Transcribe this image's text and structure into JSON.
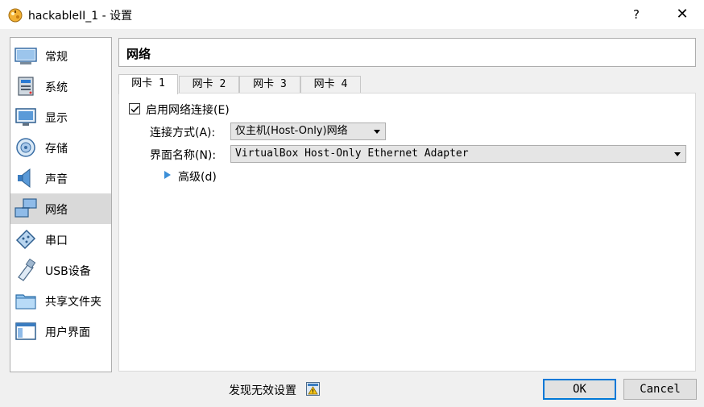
{
  "window": {
    "title": "hackableII_1 - 设置",
    "help_label": "?",
    "close_label": "✕"
  },
  "sidebar": {
    "items": [
      {
        "label": "常规",
        "icon": "general-icon"
      },
      {
        "label": "系统",
        "icon": "system-icon"
      },
      {
        "label": "显示",
        "icon": "display-icon"
      },
      {
        "label": "存储",
        "icon": "storage-icon"
      },
      {
        "label": "声音",
        "icon": "audio-icon"
      },
      {
        "label": "网络",
        "icon": "network-icon",
        "selected": true
      },
      {
        "label": "串口",
        "icon": "serial-port-icon"
      },
      {
        "label": "USB设备",
        "icon": "usb-icon"
      },
      {
        "label": "共享文件夹",
        "icon": "shared-folder-icon"
      },
      {
        "label": "用户界面",
        "icon": "user-interface-icon"
      }
    ]
  },
  "section": {
    "title": "网络"
  },
  "tabs": [
    {
      "label": "网卡 1",
      "active": true
    },
    {
      "label": "网卡 2"
    },
    {
      "label": "网卡 3"
    },
    {
      "label": "网卡 4"
    }
  ],
  "adapter": {
    "enable_label": "启用网络连接(E)",
    "enabled": true,
    "attached_to_label": "连接方式(A):",
    "attached_to_value": "仅主机(Host-Only)网络",
    "name_label": "界面名称(N):",
    "name_value": "VirtualBox Host-Only Ethernet Adapter",
    "advanced_label": "高级(d)"
  },
  "footer": {
    "invalid_settings_label": "发现无效设置",
    "ok_label": "OK",
    "cancel_label": "Cancel"
  },
  "colors": {
    "accent": "#0078d7",
    "selected_bg": "#d9d9d9",
    "expander": "#3c8fd8"
  }
}
